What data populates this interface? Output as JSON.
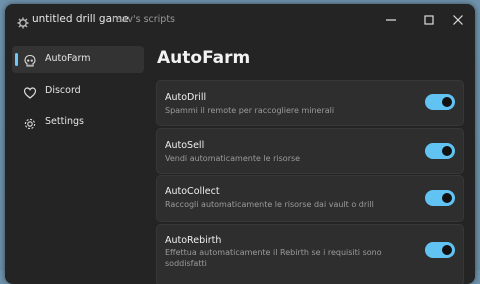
{
  "window": {
    "title": "untitled drill game",
    "subtitle": "reav's scripts"
  },
  "sidebar": {
    "items": [
      {
        "label": "AutoFarm",
        "icon": "skull-icon",
        "active": true
      },
      {
        "label": "Discord",
        "icon": "heart-icon",
        "active": false
      },
      {
        "label": "Settings",
        "icon": "gear-icon",
        "active": false
      }
    ]
  },
  "main": {
    "title": "AutoFarm",
    "toggles": [
      {
        "title": "AutoDrill",
        "description": "Spammi il remote per raccogliere minerali",
        "enabled": true
      },
      {
        "title": "AutoSell",
        "description": "Vendi automaticamente le risorse",
        "enabled": true
      },
      {
        "title": "AutoCollect",
        "description": "Raccogli automaticamente le risorse dai vault o drill",
        "enabled": true
      },
      {
        "title": "AutoRebirth",
        "description": "Effettua automaticamente il Rebirth se i requisiti sono soddisfatti",
        "enabled": true
      }
    ]
  },
  "colors": {
    "accent": "#60c3f1",
    "window_bg": "#242424",
    "card_bg": "#2e2e2e"
  }
}
